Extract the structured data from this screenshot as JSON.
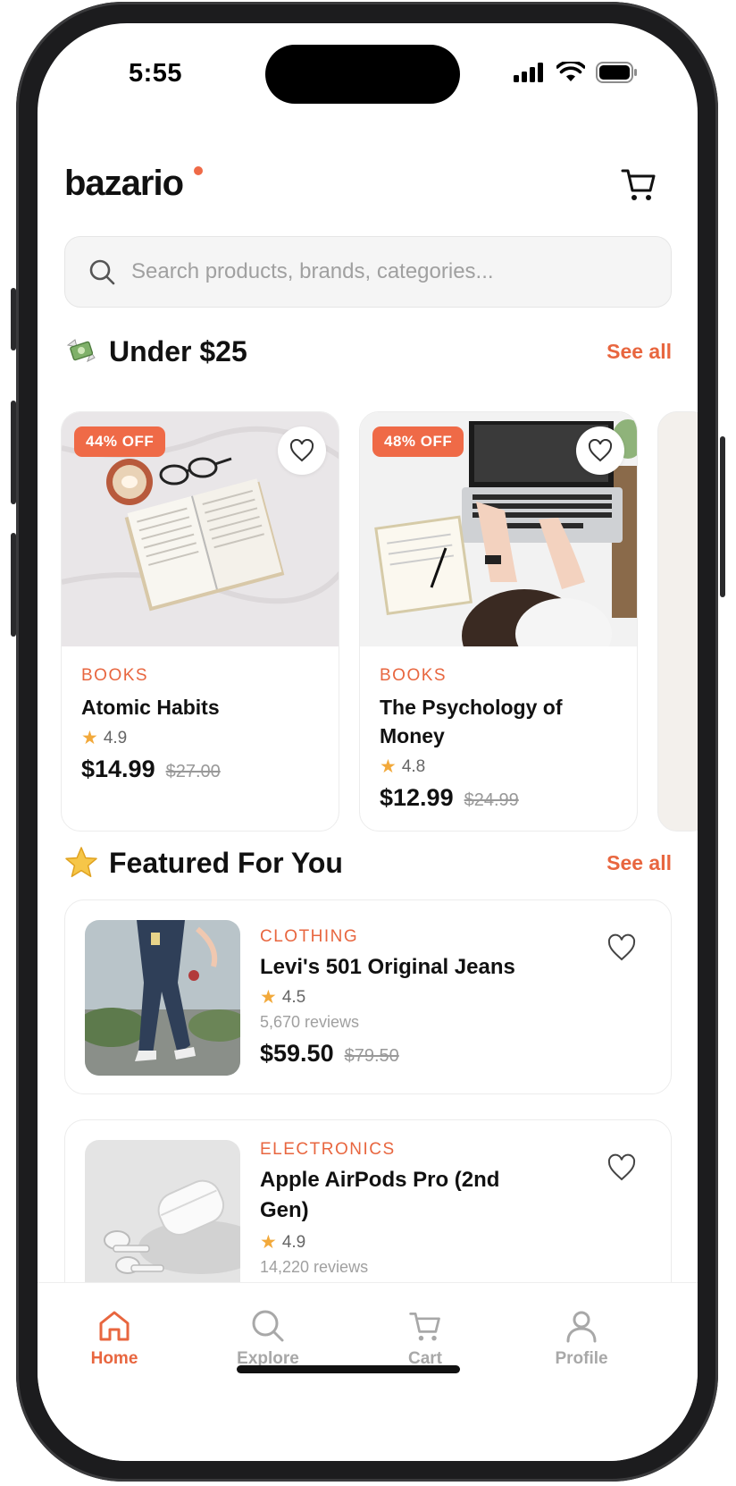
{
  "status_bar": {
    "time": "5:55"
  },
  "header": {
    "logo": "bazario"
  },
  "search": {
    "placeholder": "Search products, brands, categories..."
  },
  "sections": {
    "under": {
      "title": "Under $25",
      "see_all": "See all"
    },
    "featured": {
      "title": "Featured For You",
      "see_all": "See all"
    }
  },
  "under_products": [
    {
      "badge": "44% OFF",
      "category": "BOOKS",
      "name": "Atomic Habits",
      "rating": "4.9",
      "price": "$14.99",
      "old_price": "$27.00"
    },
    {
      "badge": "48% OFF",
      "category": "BOOKS",
      "name": "The Psychology of Money",
      "rating": "4.8",
      "price": "$12.99",
      "old_price": "$24.99"
    }
  ],
  "featured_products": [
    {
      "category": "CLOTHING",
      "name": "Levi's 501 Original Jeans",
      "rating": "4.5",
      "reviews": "5,670 reviews",
      "price": "$59.50",
      "old_price": "$79.50"
    },
    {
      "category": "ELECTRONICS",
      "name": "Apple AirPods Pro (2nd Gen)",
      "rating": "4.9",
      "reviews": "14,220 reviews"
    }
  ],
  "tabs": [
    {
      "label": "Home",
      "icon": "home-icon",
      "active": true
    },
    {
      "label": "Explore",
      "icon": "search-icon",
      "active": false
    },
    {
      "label": "Cart",
      "icon": "cart-icon",
      "active": false
    },
    {
      "label": "Profile",
      "icon": "profile-icon",
      "active": false
    }
  ],
  "colors": {
    "accent": "#e8663f",
    "star": "#f2a93b",
    "text": "#111111",
    "muted": "#999999"
  }
}
